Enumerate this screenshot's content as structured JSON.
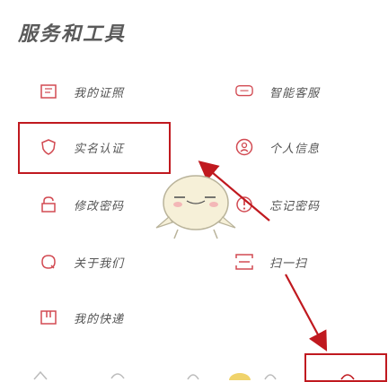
{
  "section_title": "服务和工具",
  "items_left": [
    {
      "label": "我的证照",
      "icon": "certificate-icon"
    },
    {
      "label": "实名认证",
      "icon": "shield-icon"
    },
    {
      "label": "修改密码",
      "icon": "lock-icon"
    },
    {
      "label": "关于我们",
      "icon": "info-icon"
    },
    {
      "label": "我的快递",
      "icon": "package-icon"
    }
  ],
  "items_right": [
    {
      "label": "智能客服",
      "icon": "chat-icon"
    },
    {
      "label": "个人信息",
      "icon": "user-icon"
    },
    {
      "label": "忘记密码",
      "icon": "key-icon"
    },
    {
      "label": "扫一扫",
      "icon": "scan-icon"
    }
  ],
  "colors": {
    "accent": "#c0191f",
    "icon": "#d24a52",
    "text": "#555555"
  }
}
